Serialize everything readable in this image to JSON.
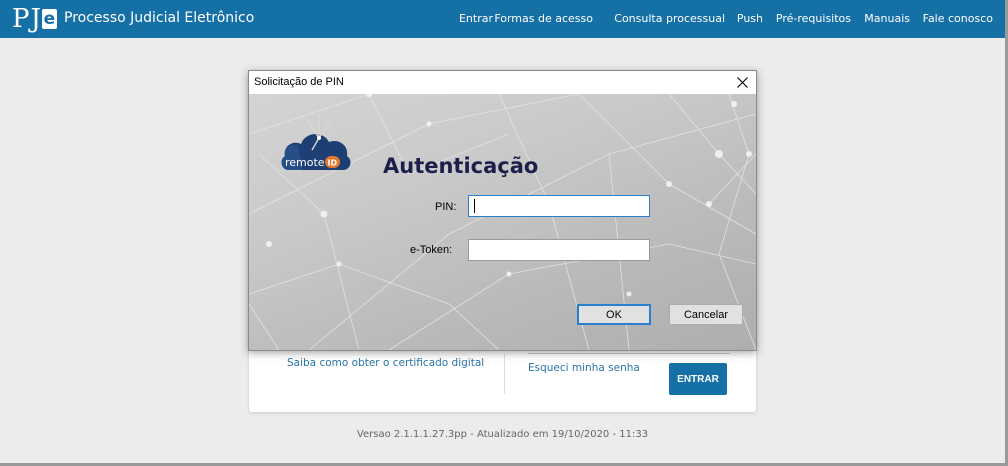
{
  "header": {
    "logo_p": "P",
    "logo_j": "J",
    "logo_e": "e",
    "title": "Processo Judicial Eletrônico",
    "nav": [
      "Entrar",
      "Formas de acesso",
      "Consulta processual",
      "Push",
      "Pré-requisitos",
      "Manuais",
      "Fale conosco"
    ]
  },
  "login_card": {
    "cert_link": "Saiba como obter o certificado digital",
    "forgot_link": "Esqueci minha senha",
    "enter_button": "ENTRAR"
  },
  "footer": {
    "version": "Versao 2.1.1.1.27.3pp - Atualizado em 19/10/2020 - 11:33"
  },
  "dialog": {
    "title": "Solicitação de PIN",
    "logo_text": "remote",
    "logo_badge": "ID",
    "heading": "Autenticação",
    "pin_label": "PIN:",
    "pin_value": "",
    "etoken_label": "e-Token:",
    "etoken_value": "",
    "ok_label": "OK",
    "cancel_label": "Cancelar"
  },
  "colors": {
    "brand": "#1570a6",
    "link": "#2a75a8",
    "heading": "#1c1f4a",
    "focus": "#2a7fd0"
  }
}
